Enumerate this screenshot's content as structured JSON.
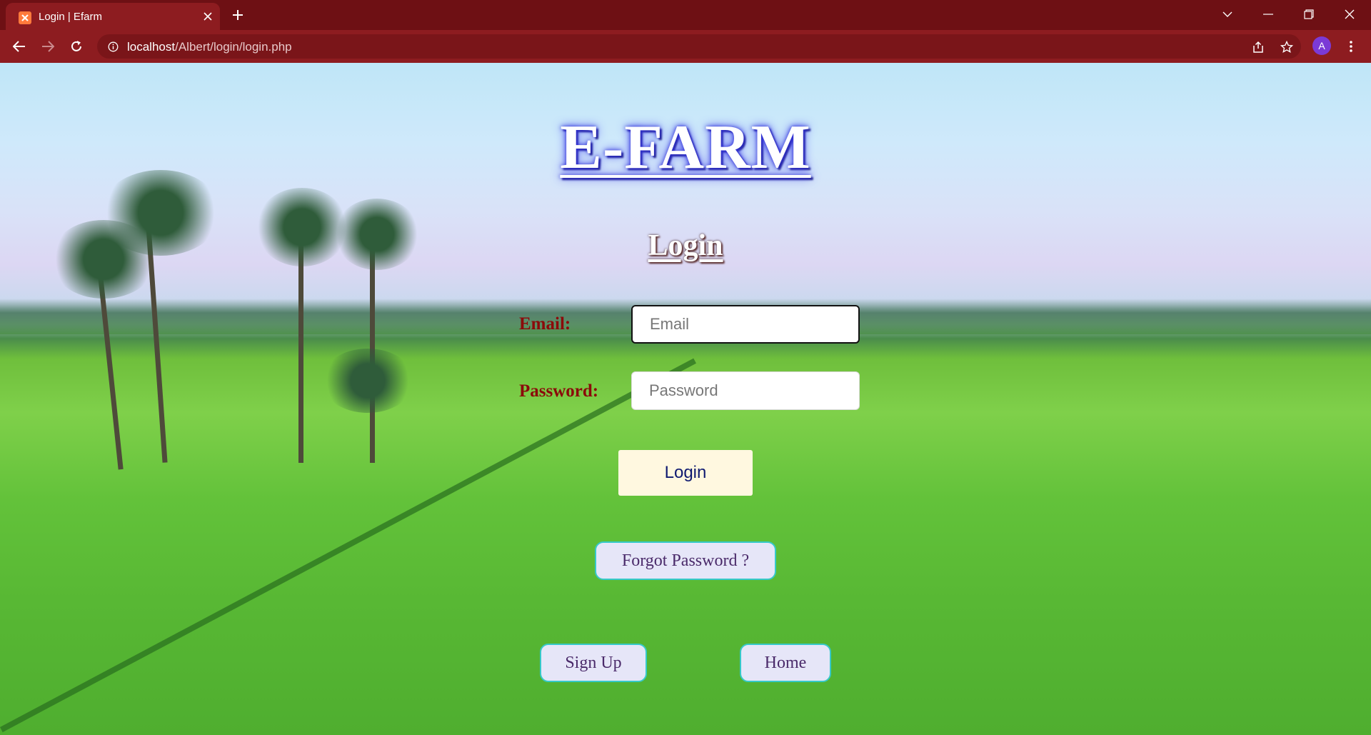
{
  "browser": {
    "tab_title": "Login | Efarm",
    "url_host": "localhost",
    "url_path": "/Albert/login/login.php",
    "profile_initial": "A"
  },
  "page": {
    "brand": "E-FARM",
    "heading": "Login",
    "email_label": "Email:",
    "email_placeholder": "Email",
    "password_label": "Password:",
    "password_placeholder": "Password",
    "login_button": "Login",
    "forgot_button": "Forgot Password ?",
    "signup_button": "Sign Up",
    "home_button": "Home"
  },
  "colors": {
    "chrome_tabbar": "#6e1014",
    "chrome_toolbar": "#8d1c20",
    "label_color": "#8b0a0a",
    "login_button_bg": "#fff8e0",
    "pill_border": "#36c9c9"
  },
  "icons": [
    "xampp-favicon-icon",
    "close-icon",
    "plus-icon",
    "chevron-down-icon",
    "minimize-icon",
    "restore-icon",
    "window-close-icon",
    "back-icon",
    "forward-icon",
    "reload-icon",
    "info-icon",
    "share-icon",
    "star-icon",
    "kebab-menu-icon"
  ]
}
